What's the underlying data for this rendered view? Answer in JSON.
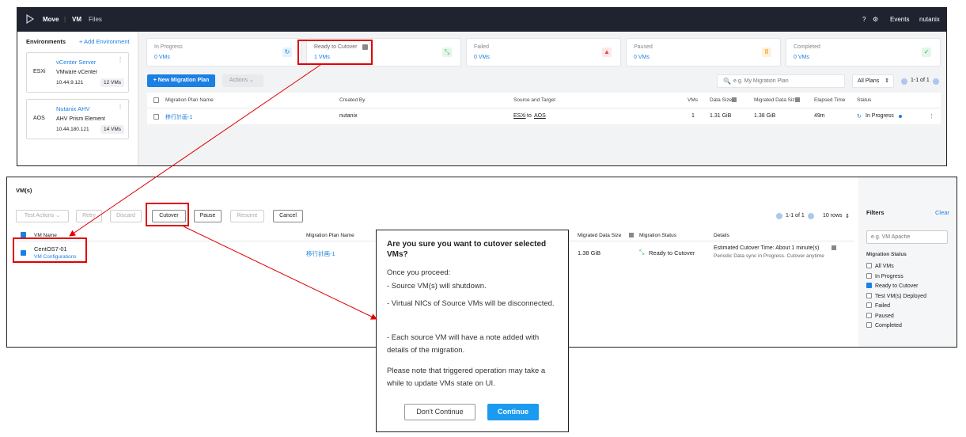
{
  "app": {
    "brand": "Move",
    "nav_vm": "VM",
    "nav_files": "Files",
    "help": "?",
    "events": "Events",
    "user": "nutanix"
  },
  "environments": {
    "title": "Environments",
    "add": "+ Add Environment",
    "items": [
      {
        "type": "ESXi",
        "name": "vCenter Server",
        "sub": "VMware vCenter",
        "ip": "10.44.9.121",
        "vms": "12 VMs"
      },
      {
        "type": "AOS",
        "name": "Nutanix AHV",
        "sub": "AHV Prism Element",
        "ip": "10.44.180.121",
        "vms": "14 VMs"
      }
    ]
  },
  "stats": [
    {
      "label": "In Progress",
      "value": "0 VMs",
      "icon": "refresh-icon",
      "color": "#1b7fe3"
    },
    {
      "label": "Ready to Cutover",
      "value": "1 VMs",
      "icon": "arrows-in-icon",
      "color": "#2bb24c"
    },
    {
      "label": "Failed",
      "value": "0 VMs",
      "icon": "warning-icon",
      "color": "#e64545"
    },
    {
      "label": "Paused",
      "value": "0 VMs",
      "icon": "pause-icon",
      "color": "#f5a623"
    },
    {
      "label": "Completed",
      "value": "0 VMs",
      "icon": "check-icon",
      "color": "#2bb24c"
    }
  ],
  "plans_toolbar": {
    "new_plan": "+ New Migration Plan",
    "actions": "Actions",
    "search_placeholder": "e.g. My Migration Plan",
    "filter": "All Plans",
    "pager": "1-1 of 1"
  },
  "plan_table": {
    "headers": [
      "Migration Plan Name",
      "Created By",
      "Source and Target",
      "VMs",
      "Data Size",
      "Migrated Data Size",
      "Elapsed Time",
      "Status"
    ],
    "row": {
      "name": "移行計画-1",
      "created_by": "nutanix",
      "source": "ESXi",
      "to": "to",
      "target": "AOS",
      "vms": "1",
      "data_size": "1.31 GiB",
      "migrated": "1.38 GiB",
      "elapsed": "49m",
      "status": "In Progress"
    }
  },
  "vm_panel": {
    "title": "VM(s)",
    "help": "?",
    "close": "×",
    "buttons": {
      "test_actions": "Test Actions",
      "retry": "Retry",
      "discard": "Discard",
      "cutover": "Cutover",
      "pause": "Pause",
      "resume": "Resume",
      "cancel": "Cancel"
    },
    "pager": "1-1 of 1",
    "rows_per_page": "10 rows",
    "headers": [
      "VM Name",
      "Migration Plan Name",
      "Migrated Data Size",
      "Migration Status",
      "Details"
    ],
    "row": {
      "vm_name": "CentOS7-01",
      "vm_config": "VM Configurations",
      "plan": "移行計画-1",
      "migrated": "1.38 GiB",
      "status": "Ready to Cutover",
      "details_main": "Estimated Cutover Time: About 1 minute(s)",
      "details_sub": "Periodic Data sync in Progress. Cutover anytime"
    }
  },
  "filters": {
    "title": "Filters",
    "clear": "Clear",
    "search_placeholder": "e.g. VM Apache",
    "section": "Migration Status",
    "options": [
      {
        "label": "All VMs",
        "checked": false
      },
      {
        "label": "In Progress",
        "checked": false
      },
      {
        "label": "Ready to Cutover",
        "checked": true
      },
      {
        "label": "Test VM(s) Deployed",
        "checked": false
      },
      {
        "label": "Failed",
        "checked": false
      },
      {
        "label": "Paused",
        "checked": false
      },
      {
        "label": "Completed",
        "checked": false
      }
    ]
  },
  "dialog": {
    "title": "Are you sure you want to cutover selected VMs?",
    "intro": "Once you proceed:",
    "point1": "- Source VM(s) will shutdown.",
    "point2": "- Virtual NICs of Source VMs will be disconnected.",
    "point3": "- Each source VM will have a note added with details of the migration.",
    "note": "Please note that triggered operation may take a while to update VMs state on UI.",
    "dont_continue": "Don't Continue",
    "continue": "Continue"
  }
}
